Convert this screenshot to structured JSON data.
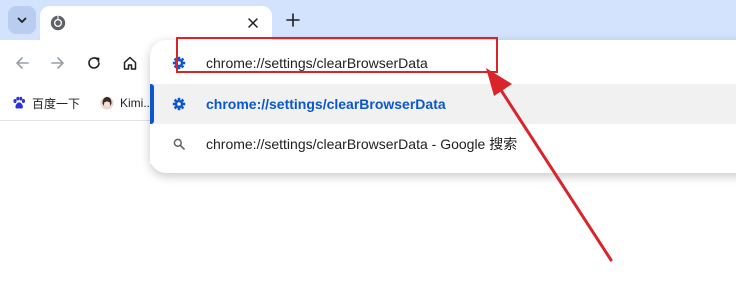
{
  "tab": {
    "title": ""
  },
  "omnibox": {
    "input_value": "chrome://settings/clearBrowserData",
    "suggestions": [
      {
        "text": "chrome://settings/clearBrowserData",
        "icon": "gear-icon"
      },
      {
        "text": "chrome://settings/clearBrowserData - Google 搜索",
        "icon": "search-icon"
      }
    ]
  },
  "bookmarks": [
    {
      "label": "百度一下",
      "icon": "baidu-paw-icon"
    },
    {
      "label": "Kimi...",
      "icon": "kimi-avatar-icon"
    }
  ],
  "colors": {
    "tabstrip": "#d3e3fd",
    "accent": "#0b57d0",
    "annotation": "#d9242b"
  }
}
